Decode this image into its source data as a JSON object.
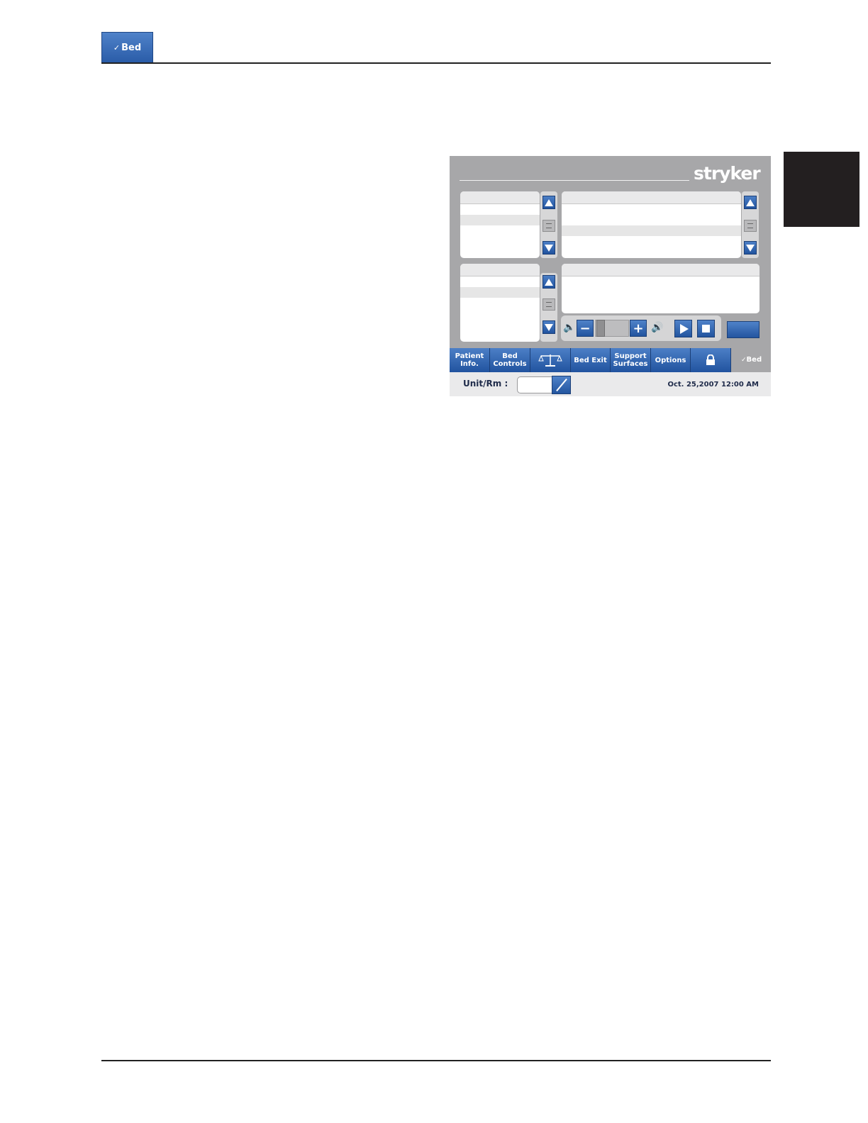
{
  "header": {
    "badge_label": "Bed"
  },
  "screen": {
    "brand": "stryker",
    "nav_tabs": [
      {
        "label": "Patient\nInfo.",
        "icon": null
      },
      {
        "label": "Bed\nControls",
        "icon": null
      },
      {
        "label": "",
        "icon": "scale-icon"
      },
      {
        "label": "Bed Exit",
        "icon": null
      },
      {
        "label": "Support\nSurfaces",
        "icon": null
      },
      {
        "label": "Options",
        "icon": null
      },
      {
        "label": "",
        "icon": "lock-icon"
      }
    ],
    "nav_logo": "Bed",
    "status": {
      "unit_label": "Unit/Rm :",
      "unit_value": "",
      "datetime": "Oct. 25,2007  12:00 AM"
    }
  },
  "colors": {
    "accent_blue": "#2a5ca8",
    "screen_gray": "#a7a7a9",
    "side_tab": "#231f20"
  }
}
